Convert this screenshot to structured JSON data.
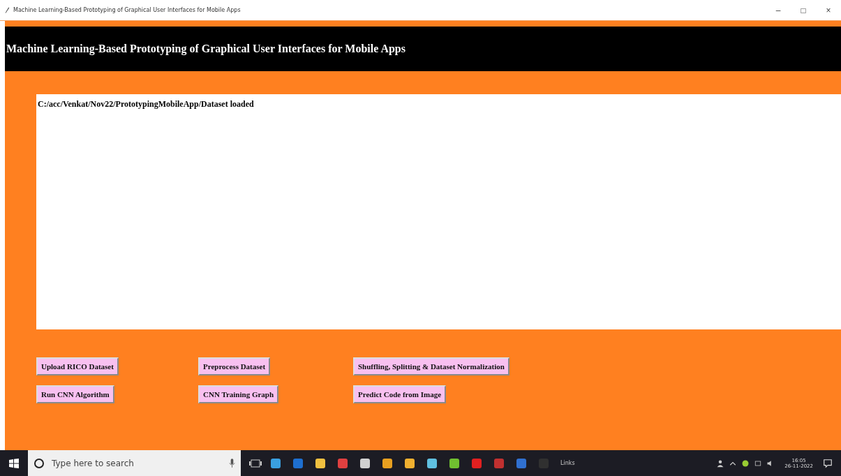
{
  "window": {
    "title": "Machine Learning-Based Prototyping of Graphical User Interfaces for Mobile Apps",
    "controls": [
      "–",
      "□",
      "×"
    ]
  },
  "header": {
    "title": "Machine Learning-Based Prototyping of Graphical User Interfaces for Mobile Apps"
  },
  "output": {
    "text": "C:/acc/Venkat/Nov22/PrototypingMobileApp/Dataset loaded"
  },
  "buttons": [
    [
      "Upload RICO Dataset",
      "Preprocess Dataset",
      "Shuffling, Splitting & Dataset Normalization"
    ],
    [
      "Run CNN Algorithm",
      "CNN Training Graph",
      "Predict Code from Image"
    ]
  ],
  "taskbar": {
    "search": {
      "placeholder": "Type here to search"
    },
    "links": "Links",
    "time": "16:05",
    "date": "26-11-2022"
  }
}
